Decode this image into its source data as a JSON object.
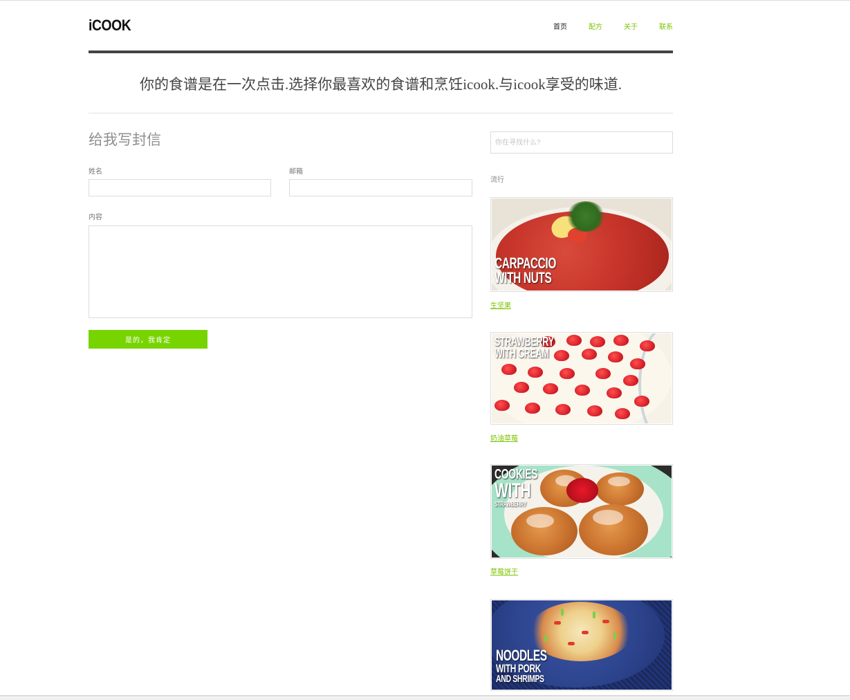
{
  "header": {
    "logo": "iCOOK",
    "nav": [
      {
        "label": "首页",
        "active": true
      },
      {
        "label": "配方",
        "active": false
      },
      {
        "label": "关于",
        "active": false
      },
      {
        "label": "联系",
        "active": false
      }
    ]
  },
  "tagline": "你的食谱是在一次点击.选择你最喜欢的食谱和烹饪icook.与icook享受的味道.",
  "contact_form": {
    "title": "给我写封信",
    "name_label": "姓名",
    "name_value": "",
    "email_label": "邮箱",
    "email_value": "",
    "content_label": "内容",
    "content_value": "",
    "submit_label": "是的，我肯定"
  },
  "sidebar": {
    "search_placeholder": "你在寻找什么?",
    "popular_label": "流行",
    "recipes": [
      {
        "overlay": [
          "CARPACCIO",
          "WITH NUTS"
        ],
        "link": "生坚果",
        "image_icon": "carpaccio-image"
      },
      {
        "overlay": [
          "STRAWBERRY",
          "WITH CREAM"
        ],
        "link": "奶油草莓",
        "image_icon": "strawberry-cream-image"
      },
      {
        "overlay": [
          "COOKIES",
          "WITH",
          "STRAWBERRY"
        ],
        "link": "草莓饼干",
        "image_icon": "cookies-image"
      },
      {
        "overlay": [
          "NOODLES",
          "WITH PORK",
          "AND SHRIMPS"
        ],
        "link": "",
        "image_icon": "noodles-image"
      }
    ]
  },
  "colors": {
    "accent": "#7dc400",
    "button": "#78d400",
    "rule": "#444444"
  }
}
